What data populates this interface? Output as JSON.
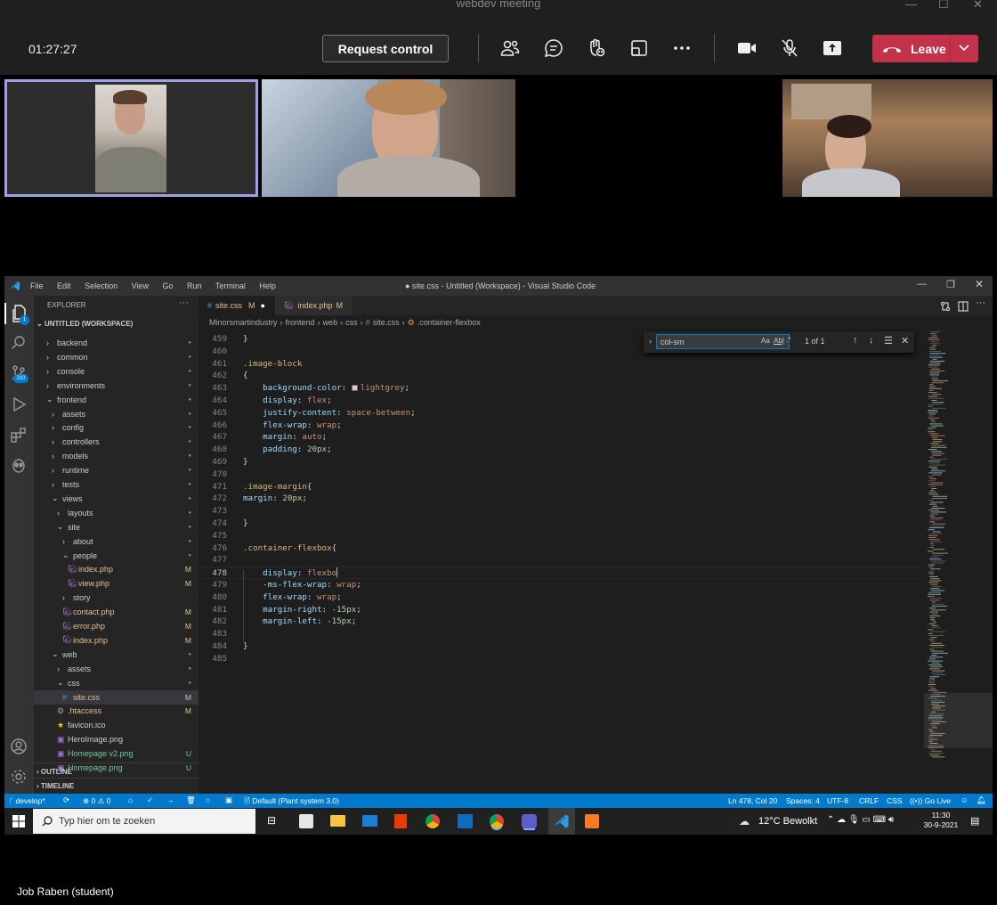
{
  "meeting": {
    "window_title": "webdev meeting",
    "timer": "01:27:27",
    "request_control_label": "Request control",
    "leave_label": "Leave",
    "participant_name": "Job Raben (student)",
    "accent_leave": "#c4314b",
    "active_tile_border": "#9da0e8"
  },
  "vscode": {
    "menu": [
      "File",
      "Edit",
      "Selection",
      "View",
      "Go",
      "Run",
      "Terminal",
      "Help"
    ],
    "window_title": "● site.css - Untitled (Workspace) - Visual Studio Code",
    "activity_badges": {
      "explorer": "1",
      "source_control": "210"
    },
    "explorer_label": "EXPLORER",
    "workspace_label": "UNTITLED (WORKSPACE)",
    "tree": [
      {
        "label": "backend",
        "type": "folder",
        "state": "closed",
        "depth": 1,
        "status": "●"
      },
      {
        "label": "common",
        "type": "folder",
        "state": "closed",
        "depth": 1,
        "status": "●"
      },
      {
        "label": "console",
        "type": "folder",
        "state": "closed",
        "depth": 1,
        "status": "●"
      },
      {
        "label": "environments",
        "type": "folder",
        "state": "closed",
        "depth": 1,
        "status": "●"
      },
      {
        "label": "frontend",
        "type": "folder",
        "state": "open",
        "depth": 1,
        "status": "●"
      },
      {
        "label": "assets",
        "type": "folder",
        "state": "closed",
        "depth": 2,
        "status": "●"
      },
      {
        "label": "config",
        "type": "folder",
        "state": "closed",
        "depth": 2,
        "status": "●"
      },
      {
        "label": "controllers",
        "type": "folder",
        "state": "closed",
        "depth": 2,
        "status": "●"
      },
      {
        "label": "models",
        "type": "folder",
        "state": "closed",
        "depth": 2,
        "status": "●"
      },
      {
        "label": "runtime",
        "type": "folder",
        "state": "closed",
        "depth": 2,
        "status": "●"
      },
      {
        "label": "tests",
        "type": "folder",
        "state": "closed",
        "depth": 2,
        "status": "●"
      },
      {
        "label": "views",
        "type": "folder",
        "state": "open",
        "depth": 2,
        "status": "●"
      },
      {
        "label": "layouts",
        "type": "folder",
        "state": "closed",
        "depth": 3,
        "status": "●"
      },
      {
        "label": "site",
        "type": "folder",
        "state": "open",
        "depth": 3,
        "status": "●"
      },
      {
        "label": "about",
        "type": "folder",
        "state": "closed",
        "depth": 4,
        "status": "●"
      },
      {
        "label": "people",
        "type": "folder",
        "state": "open",
        "depth": 4,
        "status": "●"
      },
      {
        "label": "index.php",
        "type": "php",
        "depth": 5,
        "status": "M"
      },
      {
        "label": "view.php",
        "type": "php",
        "depth": 5,
        "status": "M"
      },
      {
        "label": "story",
        "type": "folder",
        "state": "closed",
        "depth": 4,
        "status": ""
      },
      {
        "label": "contact.php",
        "type": "php",
        "depth": 4,
        "status": "M"
      },
      {
        "label": "error.php",
        "type": "php",
        "depth": 4,
        "status": "M"
      },
      {
        "label": "index.php",
        "type": "php",
        "depth": 4,
        "status": "M"
      },
      {
        "label": "web",
        "type": "folder",
        "state": "open",
        "depth": 2,
        "status": "●"
      },
      {
        "label": "assets",
        "type": "folder",
        "state": "closed",
        "depth": 3,
        "status": "●"
      },
      {
        "label": "css",
        "type": "folder",
        "state": "open",
        "depth": 3,
        "status": "●"
      },
      {
        "label": "site.css",
        "type": "css",
        "depth": 4,
        "status": "M",
        "selected": true
      },
      {
        "label": ".htaccess",
        "type": "gear",
        "depth": 3,
        "status": "M"
      },
      {
        "label": "favicon.ico",
        "type": "star",
        "depth": 3,
        "status": ""
      },
      {
        "label": "HeroImage.png",
        "type": "img",
        "depth": 3,
        "status": ""
      },
      {
        "label": "Homepage v2.png",
        "type": "img",
        "depth": 3,
        "status": "U",
        "green": true
      },
      {
        "label": "Homepage.png",
        "type": "img",
        "depth": 3,
        "status": "U",
        "green": true
      }
    ],
    "outline_label": "OUTLINE",
    "timeline_label": "TIMELINE",
    "tabs": [
      {
        "label": "site.css",
        "status": "M",
        "active": true,
        "dirty": "●"
      },
      {
        "label": "index.php",
        "status": "M",
        "active": false
      }
    ],
    "breadcrumb": [
      "Minorsmartindustry",
      "frontend",
      "web",
      "css",
      "site.css",
      ".container-flexbox"
    ],
    "find": {
      "query": "col-sm",
      "opt_case": "Aa",
      "opt_word": "Ab|",
      "opt_regex": ".*",
      "result": "1 of 1"
    },
    "code_lines": [
      {
        "n": "459",
        "t": [
          [
            "pun",
            "}"
          ]
        ]
      },
      {
        "n": "460",
        "t": []
      },
      {
        "n": "461",
        "t": [
          [
            "sel",
            ".image-block"
          ]
        ]
      },
      {
        "n": "462",
        "t": [
          [
            "pun",
            "{"
          ]
        ]
      },
      {
        "n": "463",
        "t": [
          [
            "ind",
            "    "
          ],
          [
            "prop",
            "background-color"
          ],
          [
            "pun",
            ": "
          ],
          [
            "swatch",
            ""
          ],
          [
            "val",
            "lightgrey"
          ],
          [
            "pun",
            ";"
          ]
        ]
      },
      {
        "n": "464",
        "t": [
          [
            "ind",
            "    "
          ],
          [
            "prop",
            "display"
          ],
          [
            "pun",
            ": "
          ],
          [
            "val",
            "flex"
          ],
          [
            "pun",
            ";"
          ]
        ]
      },
      {
        "n": "465",
        "t": [
          [
            "ind",
            "    "
          ],
          [
            "prop",
            "justify-content"
          ],
          [
            "pun",
            ": "
          ],
          [
            "val",
            "space-between"
          ],
          [
            "pun",
            ";"
          ]
        ]
      },
      {
        "n": "466",
        "t": [
          [
            "ind",
            "    "
          ],
          [
            "prop",
            "flex-wrap"
          ],
          [
            "pun",
            ": "
          ],
          [
            "val",
            "wrap"
          ],
          [
            "pun",
            ";"
          ]
        ]
      },
      {
        "n": "467",
        "t": [
          [
            "ind",
            "    "
          ],
          [
            "prop",
            "margin"
          ],
          [
            "pun",
            ": "
          ],
          [
            "val",
            "auto"
          ],
          [
            "pun",
            ";"
          ]
        ]
      },
      {
        "n": "468",
        "t": [
          [
            "ind",
            "    "
          ],
          [
            "prop",
            "padding"
          ],
          [
            "pun",
            ": "
          ],
          [
            "num",
            "20px"
          ],
          [
            "pun",
            ";"
          ]
        ]
      },
      {
        "n": "469",
        "t": [
          [
            "pun",
            "}"
          ]
        ]
      },
      {
        "n": "470",
        "t": []
      },
      {
        "n": "471",
        "t": [
          [
            "sel",
            ".image-margin"
          ],
          [
            "pun",
            "{"
          ]
        ]
      },
      {
        "n": "472",
        "t": [
          [
            "prop",
            "margin"
          ],
          [
            "pun",
            ": "
          ],
          [
            "num",
            "20px"
          ],
          [
            "pun",
            ";"
          ]
        ]
      },
      {
        "n": "473",
        "t": []
      },
      {
        "n": "474",
        "t": [
          [
            "pun",
            "}"
          ]
        ]
      },
      {
        "n": "475",
        "t": []
      },
      {
        "n": "476",
        "t": [
          [
            "sel",
            ".container-flexbox"
          ],
          [
            "pun",
            "{"
          ]
        ]
      },
      {
        "n": "477",
        "t": []
      },
      {
        "n": "478",
        "t": [
          [
            "ind",
            "    "
          ],
          [
            "prop",
            "display"
          ],
          [
            "pun",
            ": "
          ],
          [
            "val",
            "flexbo"
          ]
        ],
        "current": true
      },
      {
        "n": "479",
        "t": [
          [
            "ind",
            "    "
          ],
          [
            "prop",
            "-ms-flex-wrap"
          ],
          [
            "pun",
            ": "
          ],
          [
            "val",
            "wrap"
          ],
          [
            "pun",
            ";"
          ]
        ]
      },
      {
        "n": "480",
        "t": [
          [
            "ind",
            "    "
          ],
          [
            "prop",
            "flex-wrap"
          ],
          [
            "pun",
            ": "
          ],
          [
            "val",
            "wrap"
          ],
          [
            "pun",
            ";"
          ]
        ]
      },
      {
        "n": "481",
        "t": [
          [
            "ind",
            "    "
          ],
          [
            "prop",
            "margin-right"
          ],
          [
            "pun",
            ": "
          ],
          [
            "num",
            "-15px"
          ],
          [
            "pun",
            ";"
          ]
        ]
      },
      {
        "n": "482",
        "t": [
          [
            "ind",
            "    "
          ],
          [
            "prop",
            "margin-left"
          ],
          [
            "pun",
            ": "
          ],
          [
            "num",
            "-15px"
          ],
          [
            "pun",
            ";"
          ]
        ]
      },
      {
        "n": "483",
        "t": []
      },
      {
        "n": "484",
        "t": [
          [
            "pun",
            "}"
          ]
        ]
      },
      {
        "n": "485",
        "t": []
      }
    ],
    "status": {
      "branch": "develop*",
      "errors": "0",
      "warnings": "0",
      "plant": "Default (Plant system 3.0)",
      "position": "Ln 478, Col 20",
      "spaces": "Spaces: 4",
      "encoding": "UTF-8",
      "eol": "CRLF",
      "lang": "CSS",
      "golive": "Go Live"
    },
    "status_color": "#007acc"
  },
  "taskbar": {
    "search_placeholder": "Typ hier om te zoeken",
    "weather": "12°C  Bewolkt",
    "time": "11:30",
    "date": "30-9-2021"
  }
}
